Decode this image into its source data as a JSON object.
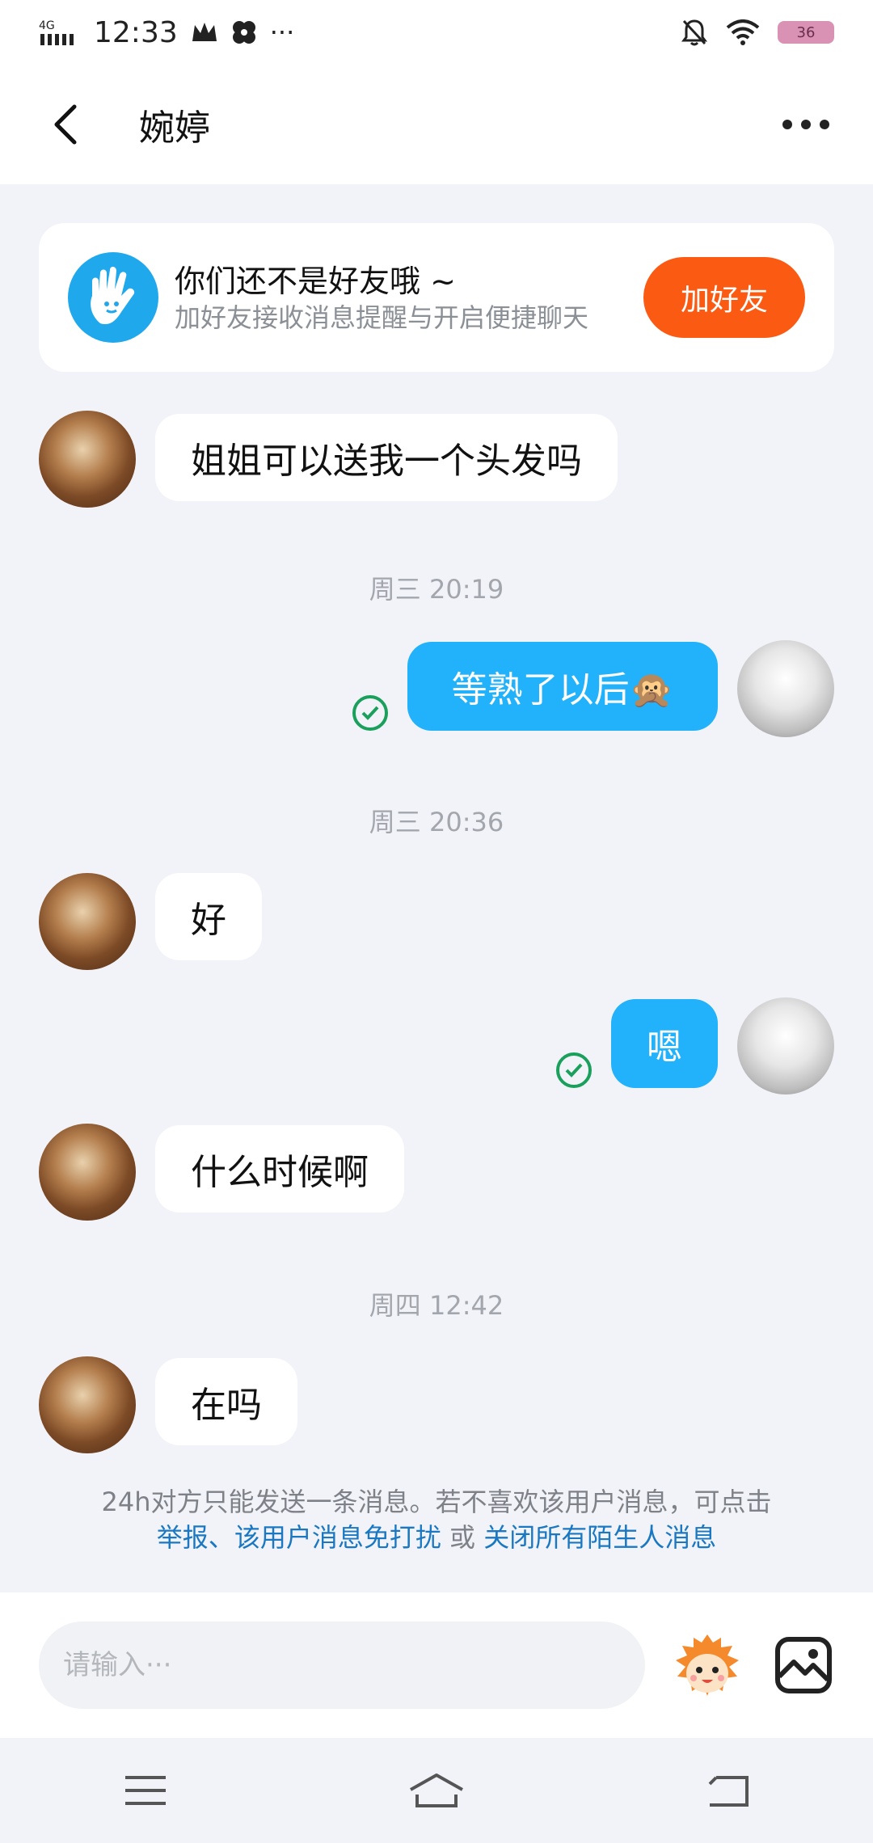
{
  "status_bar": {
    "network": "4G HD",
    "time": "12:33",
    "extra": "···",
    "battery": "36"
  },
  "header": {
    "title": "婉婷"
  },
  "friend_banner": {
    "title": "你们还不是好友哦 ~",
    "subtitle": "加好友接收消息提醒与开启便捷聊天",
    "button": "加好友"
  },
  "messages": [
    {
      "side": "left",
      "text": "姐姐可以送我一个头发吗"
    },
    {
      "type": "timestamp",
      "text": "周三 20:19"
    },
    {
      "side": "right",
      "text": "等熟了以后🙊"
    },
    {
      "type": "timestamp",
      "text": "周三 20:36"
    },
    {
      "side": "left",
      "text": "好"
    },
    {
      "side": "right",
      "text": "嗯"
    },
    {
      "side": "left",
      "text": "什么时候啊"
    },
    {
      "type": "timestamp",
      "text": "周四 12:42"
    },
    {
      "side": "left",
      "text": "在吗"
    }
  ],
  "notice": {
    "text": "24h对方只能发送一条消息。若不喜欢该用户消息，可点击",
    "link_report": "举报",
    "sep": "、",
    "link_mute": "该用户消息免打扰",
    "or": " 或 ",
    "link_close": "关闭所有陌生人消息"
  },
  "input": {
    "placeholder": "请输入···"
  },
  "colors": {
    "accent_blue": "#22b1fb",
    "add_friend_orange": "#fb5a12",
    "link_blue": "#1a78c2"
  }
}
